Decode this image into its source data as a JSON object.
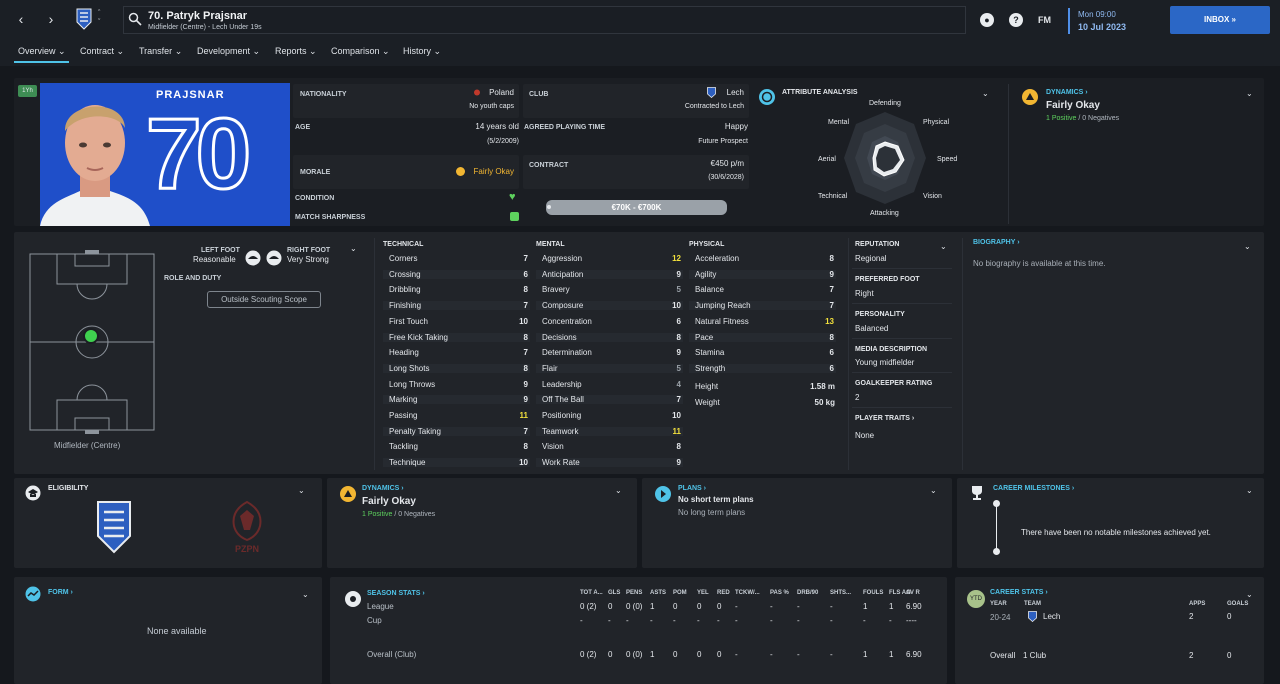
{
  "header": {
    "name": "70. Patryk Prajsnar",
    "subtitle": "Midfielder (Centre) - Lech Under 19s",
    "fm_label": "FM",
    "date_day": "Mon 09:00",
    "date": "10 Jul 2023",
    "inbox": "INBOX"
  },
  "menu": [
    "Overview",
    "Contract",
    "Transfer",
    "Development",
    "Reports",
    "Comparison",
    "History"
  ],
  "profile": {
    "badge": "1Yh",
    "shirt_name": "PRAJSNAR",
    "shirt_number": "70",
    "nationality_label": "NATIONALITY",
    "nationality": "Poland",
    "youth_caps": "No youth caps",
    "age_label": "AGE",
    "age": "14 years old",
    "dob": "(5/2/2009)",
    "morale_label": "MORALE",
    "morale": "Fairly Okay",
    "condition_label": "CONDITION",
    "sharpness_label": "MATCH SHARPNESS",
    "club_label": "CLUB",
    "club": "Lech",
    "contracted": "Contracted to Lech",
    "playing_time_label": "AGREED PLAYING TIME",
    "playing_time": "Happy",
    "prospect": "Future Prospect",
    "contract_label": "CONTRACT",
    "wage": "€450 p/m",
    "expiry": "(30/6/2028)",
    "value": "€70K - €700K"
  },
  "analysis": {
    "title": "ATTRIBUTE ANALYSIS",
    "labels": [
      "Defending",
      "Physical",
      "Speed",
      "Vision",
      "Attacking",
      "Technical",
      "Aerial",
      "Mental"
    ]
  },
  "dynamics_top": {
    "title": "DYNAMICS",
    "status": "Fairly Okay",
    "positive": "1 Positive",
    "sep": "/",
    "negative": "0 Negatives"
  },
  "pitch": {
    "position": "Midfielder (Centre)",
    "left_foot_label": "LEFT FOOT",
    "left_foot": "Reasonable",
    "right_foot_label": "RIGHT FOOT",
    "right_foot": "Very Strong",
    "role_label": "ROLE AND DUTY",
    "scope": "Outside Scouting Scope"
  },
  "technical": {
    "title": "TECHNICAL",
    "rows": [
      [
        "Corners",
        "7"
      ],
      [
        "Crossing",
        "6"
      ],
      [
        "Dribbling",
        "8"
      ],
      [
        "Finishing",
        "7"
      ],
      [
        "First Touch",
        "10"
      ],
      [
        "Free Kick Taking",
        "8"
      ],
      [
        "Heading",
        "7"
      ],
      [
        "Long Shots",
        "8"
      ],
      [
        "Long Throws",
        "9"
      ],
      [
        "Marking",
        "9"
      ],
      [
        "Passing",
        "11"
      ],
      [
        "Penalty Taking",
        "7"
      ],
      [
        "Tackling",
        "8"
      ],
      [
        "Technique",
        "10"
      ]
    ]
  },
  "mental": {
    "title": "MENTAL",
    "rows": [
      [
        "Aggression",
        "12"
      ],
      [
        "Anticipation",
        "9"
      ],
      [
        "Bravery",
        "5"
      ],
      [
        "Composure",
        "10"
      ],
      [
        "Concentration",
        "6"
      ],
      [
        "Decisions",
        "8"
      ],
      [
        "Determination",
        "9"
      ],
      [
        "Flair",
        "5"
      ],
      [
        "Leadership",
        "4"
      ],
      [
        "Off The Ball",
        "7"
      ],
      [
        "Positioning",
        "10"
      ],
      [
        "Teamwork",
        "11"
      ],
      [
        "Vision",
        "8"
      ],
      [
        "Work Rate",
        "9"
      ]
    ]
  },
  "physical": {
    "title": "PHYSICAL",
    "rows": [
      [
        "Acceleration",
        "8"
      ],
      [
        "Agility",
        "9"
      ],
      [
        "Balance",
        "7"
      ],
      [
        "Jumping Reach",
        "7"
      ],
      [
        "Natural Fitness",
        "13"
      ],
      [
        "Pace",
        "8"
      ],
      [
        "Stamina",
        "6"
      ],
      [
        "Strength",
        "6"
      ]
    ],
    "height_label": "Height",
    "height": "1.58 m",
    "weight_label": "Weight",
    "weight": "50 kg"
  },
  "info": {
    "reputation_label": "REPUTATION",
    "reputation": "Regional",
    "foot_label": "PREFERRED FOOT",
    "foot": "Right",
    "personality_label": "PERSONALITY",
    "personality": "Balanced",
    "media_label": "MEDIA DESCRIPTION",
    "media": "Young midfielder",
    "gk_label": "GOALKEEPER RATING",
    "gk": "2",
    "traits_label": "PLAYER TRAITS",
    "traits": "None"
  },
  "biography": {
    "title": "BIOGRAPHY",
    "text": "No biography is available at this time."
  },
  "eligibility": {
    "title": "ELIGIBILITY"
  },
  "dynamics_mid": {
    "title": "DYNAMICS",
    "status": "Fairly Okay",
    "positive": "1 Positive",
    "sep": "/",
    "negative": "0 Negatives"
  },
  "plans": {
    "title": "PLANS",
    "short": "No short term plans",
    "long": "No long term plans"
  },
  "milestones": {
    "title": "CAREER MILESTONES",
    "text": "There have been no notable milestones achieved yet."
  },
  "form": {
    "title": "FORM",
    "text": "None available"
  },
  "season": {
    "title": "SEASON STATS",
    "headers": [
      "TOT A...",
      "GLS",
      "PENS",
      "ASTS",
      "POM",
      "YEL",
      "RED",
      "TCKW/...",
      "PAS %",
      "DRB/90",
      "SHTS...",
      "FOULS",
      "FLS AG",
      "AV R"
    ],
    "rows": [
      {
        "name": "League",
        "vals": [
          "0 (2)",
          "0",
          "0 (0)",
          "1",
          "0",
          "0",
          "0",
          "-",
          "-",
          "-",
          "-",
          "1",
          "1",
          "6.90"
        ]
      },
      {
        "name": "Cup",
        "vals": [
          "-",
          "-",
          "-",
          "-",
          "-",
          "-",
          "-",
          "-",
          "-",
          "-",
          "-",
          "-",
          "-",
          "----"
        ]
      },
      {
        "name": "Overall (Club)",
        "vals": [
          "0 (2)",
          "0",
          "0 (0)",
          "1",
          "0",
          "0",
          "0",
          "-",
          "-",
          "-",
          "-",
          "1",
          "1",
          "6.90"
        ]
      }
    ]
  },
  "career": {
    "title": "CAREER STATS",
    "year_label": "YEAR",
    "team_label": "TEAM",
    "apps_label": "APPS",
    "goals_label": "GOALS",
    "year": "20-24",
    "team": "Lech",
    "apps": "2",
    "goals": "0",
    "overall_label": "Overall",
    "clubs": "1 Club",
    "total_apps": "2",
    "total_goals": "0"
  },
  "colors": {
    "accent": "#4fc3e8",
    "positive": "#5ed25e",
    "highlight": "#f3e13c",
    "inbox": "#2b67c6",
    "shirt": "#1f4fc9"
  }
}
